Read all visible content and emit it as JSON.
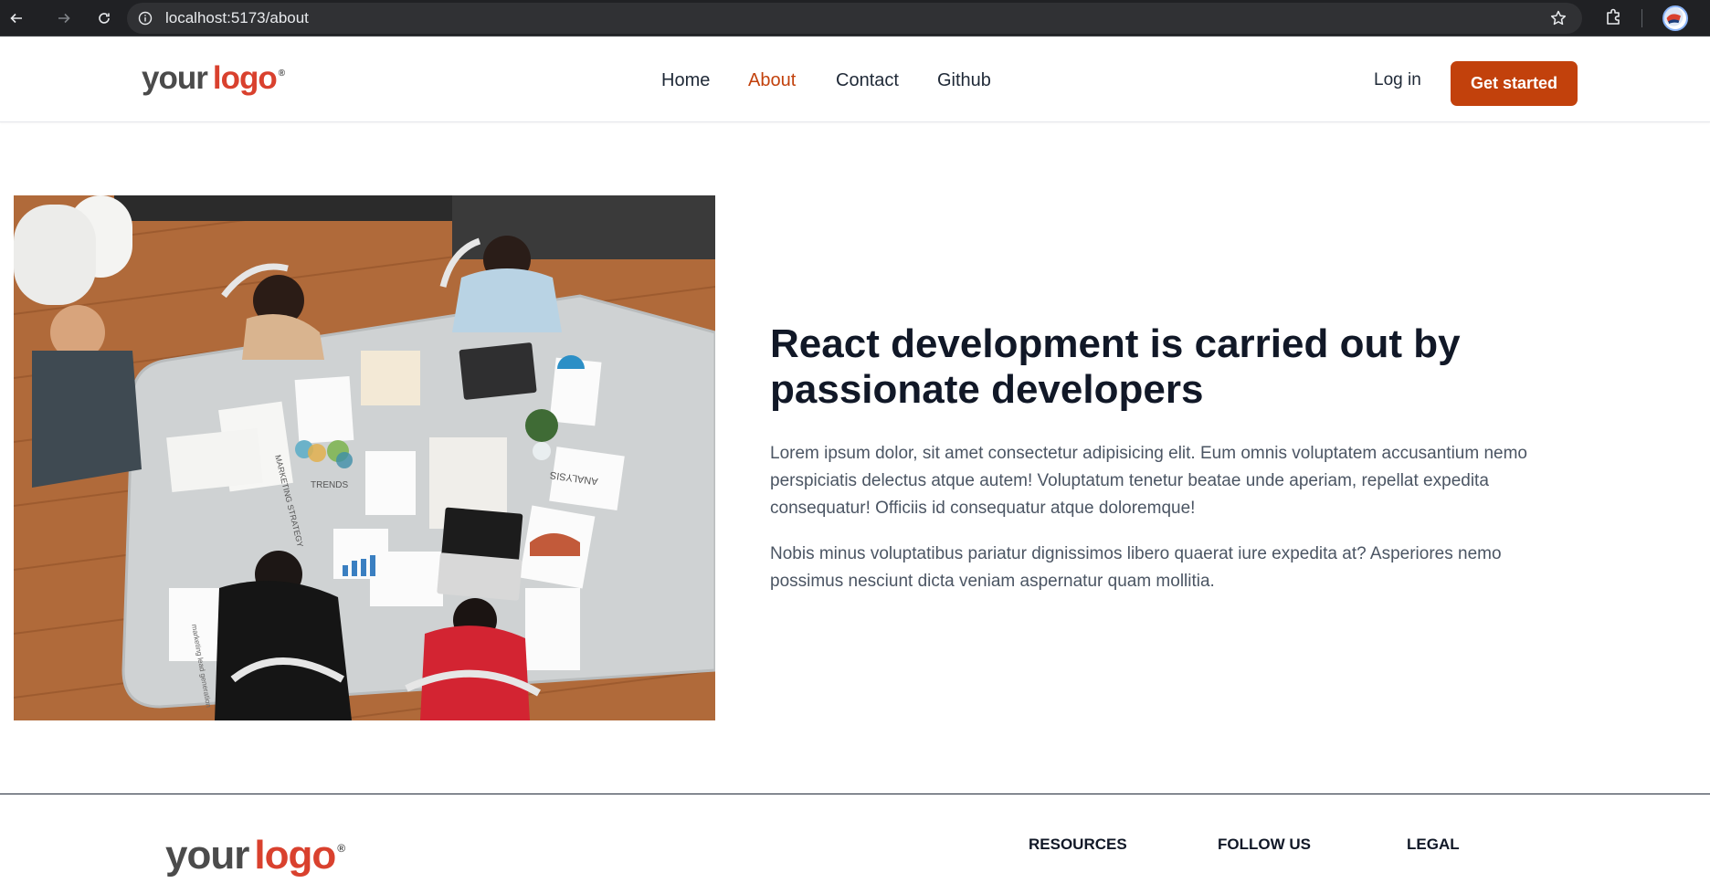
{
  "browser": {
    "url": "localhost:5173/about"
  },
  "header": {
    "logo": {
      "word1": "your",
      "word2": "logo",
      "mark": "®"
    },
    "nav": [
      {
        "label": "Home"
      },
      {
        "label": "About"
      },
      {
        "label": "Contact"
      },
      {
        "label": "Github"
      }
    ],
    "login_label": "Log in",
    "cta_label": "Get started"
  },
  "about": {
    "heading": "React development is carried out by passionate developers",
    "paragraph1": "Lorem ipsum dolor, sit amet consectetur adipisicing elit. Eum omnis voluptatem accusantium nemo perspiciatis delectus atque autem! Voluptatum tenetur beatae unde aperiam, repellat expedita consequatur! Officiis id consequatur atque doloremque!",
    "paragraph2": "Nobis minus voluptatibus pariatur dignissimos libero quaerat iure expedita at? Asperiores nemo possimus nesciunt dicta veniam aspernatur quam mollitia.",
    "image_text": {
      "marketing_strategy": "MARKETING STRATEGY",
      "trends": "TRENDS",
      "analysis": "ANALYSIS",
      "lead_generation": "marketing lead generation"
    }
  },
  "footer": {
    "logo": {
      "word1": "your",
      "word2": "logo",
      "mark": "®"
    },
    "columns": [
      {
        "title": "RESOURCES"
      },
      {
        "title": "FOLLOW US"
      },
      {
        "title": "LEGAL"
      }
    ]
  },
  "colors": {
    "accent": "#c2410c",
    "logo_red": "#d9412e",
    "heading": "#111827",
    "body_text": "#4b5563"
  },
  "icons": [
    "back-arrow-icon",
    "forward-arrow-icon",
    "reload-icon",
    "info-icon",
    "star-icon",
    "extensions-icon",
    "profile-avatar"
  ]
}
